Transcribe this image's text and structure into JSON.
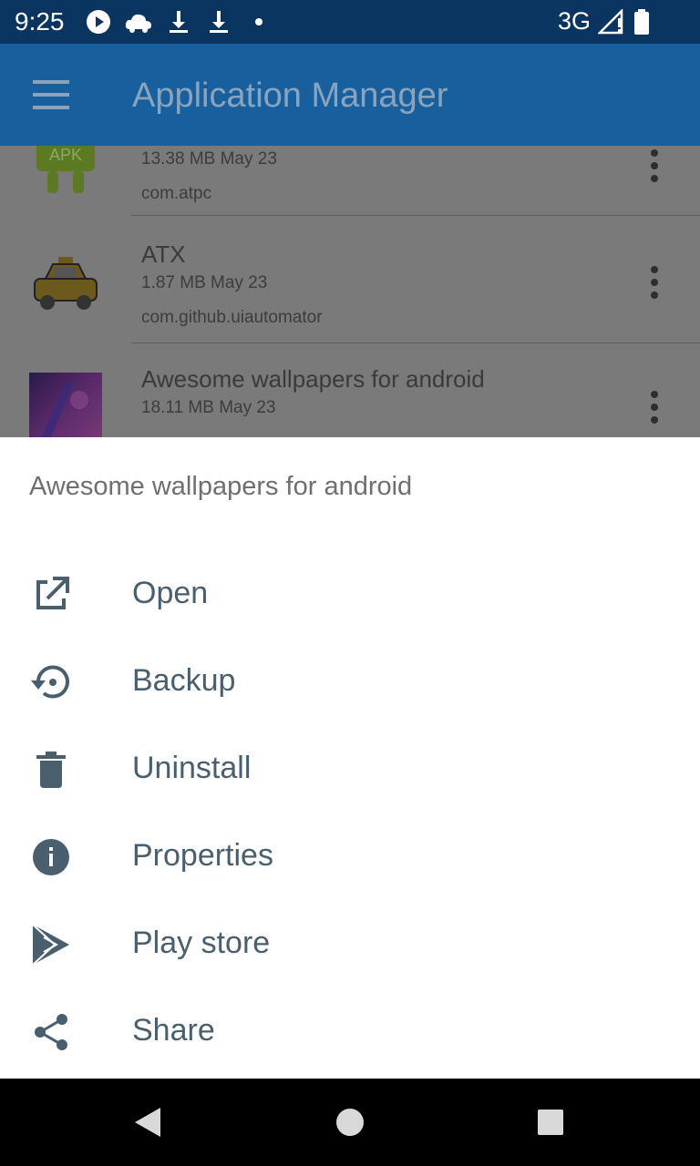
{
  "status_bar": {
    "time": "9:25",
    "network": "3G",
    "icons": [
      "play-icon",
      "cloud-icon",
      "download-icon",
      "download-icon",
      "dot-icon",
      "signal-icon",
      "battery-icon"
    ]
  },
  "app_bar": {
    "title": "Application Manager",
    "menu_icon": "hamburger-menu-icon"
  },
  "apps": [
    {
      "name": "",
      "size_date": "13.38 MB May 23",
      "package": "com.atpc",
      "icon": "apk-android-icon"
    },
    {
      "name": "ATX",
      "size_date": "1.87 MB May 23",
      "package": "com.github.uiautomator",
      "icon": "taxi-icon"
    },
    {
      "name": "Awesome wallpapers for android",
      "size_date": "18.11 MB May 23",
      "package": "",
      "icon": "wallpaper-thumbnail"
    }
  ],
  "apk_label": "APK",
  "sheet": {
    "title": "Awesome wallpapers for android",
    "items": [
      {
        "label": "Open",
        "icon": "open-external-icon"
      },
      {
        "label": "Backup",
        "icon": "backup-restore-icon"
      },
      {
        "label": "Uninstall",
        "icon": "trash-icon"
      },
      {
        "label": "Properties",
        "icon": "info-icon"
      },
      {
        "label": "Play store",
        "icon": "play-store-icon"
      },
      {
        "label": "Share",
        "icon": "share-icon"
      }
    ]
  },
  "colors": {
    "status_bar": "#0b3561",
    "app_bar": "#17609d",
    "sheet_icon": "#4a5f6e",
    "sheet_text": "#4a5f6e"
  }
}
